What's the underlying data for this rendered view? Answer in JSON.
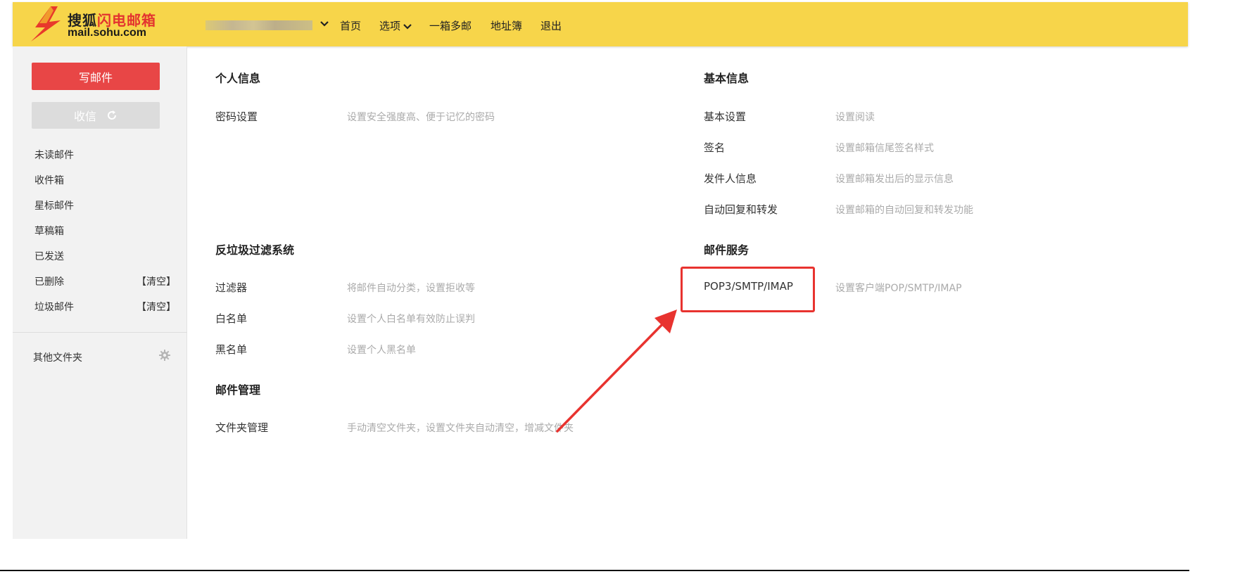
{
  "header": {
    "logo_brand_black": "搜狐",
    "logo_brand_red": "闪电邮箱",
    "logo_domain": "mail.sohu.com",
    "nav": [
      "首页",
      "选项",
      "一箱多邮",
      "地址簿",
      "退出"
    ]
  },
  "sidebar": {
    "compose_label": "写邮件",
    "receive_label": "收信",
    "folders": [
      "未读邮件",
      "收件箱",
      "星标邮件",
      "草稿箱",
      "已发送",
      "已删除",
      "垃圾邮件"
    ],
    "clear_label": "【清空】",
    "other_folders_label": "其他文件夹"
  },
  "main": {
    "personal": {
      "title": "个人信息",
      "items": [
        {
          "label": "密码设置",
          "desc": "设置安全强度高、便于记忆的密码"
        }
      ]
    },
    "antispam": {
      "title": "反垃圾过滤系统",
      "items": [
        {
          "label": "过滤器",
          "desc": "将邮件自动分类，设置拒收等"
        },
        {
          "label": "白名单",
          "desc": "设置个人白名单有效防止误判"
        },
        {
          "label": "黑名单",
          "desc": "设置个人黑名单"
        }
      ]
    },
    "mailmgmt": {
      "title": "邮件管理",
      "items": [
        {
          "label": "文件夹管理",
          "desc": "手动清空文件夹，设置文件夹自动清空，增减文件夹"
        }
      ]
    },
    "basic": {
      "title": "基本信息",
      "items": [
        {
          "label": "基本设置",
          "desc": "设置阅读"
        },
        {
          "label": "签名",
          "desc": "设置邮箱信尾签名样式"
        },
        {
          "label": "发件人信息",
          "desc": "设置邮箱发出后的显示信息"
        },
        {
          "label": "自动回复和转发",
          "desc": "设置邮箱的自动回复和转发功能"
        }
      ]
    },
    "service": {
      "title": "邮件服务",
      "items": [
        {
          "label": "POP3/SMTP/IMAP",
          "desc": "设置客户端POP/SMTP/IMAP"
        }
      ]
    }
  },
  "colors": {
    "topbar": "#f7d54a",
    "compose": "#e84646",
    "highlight": "#e8332f"
  }
}
